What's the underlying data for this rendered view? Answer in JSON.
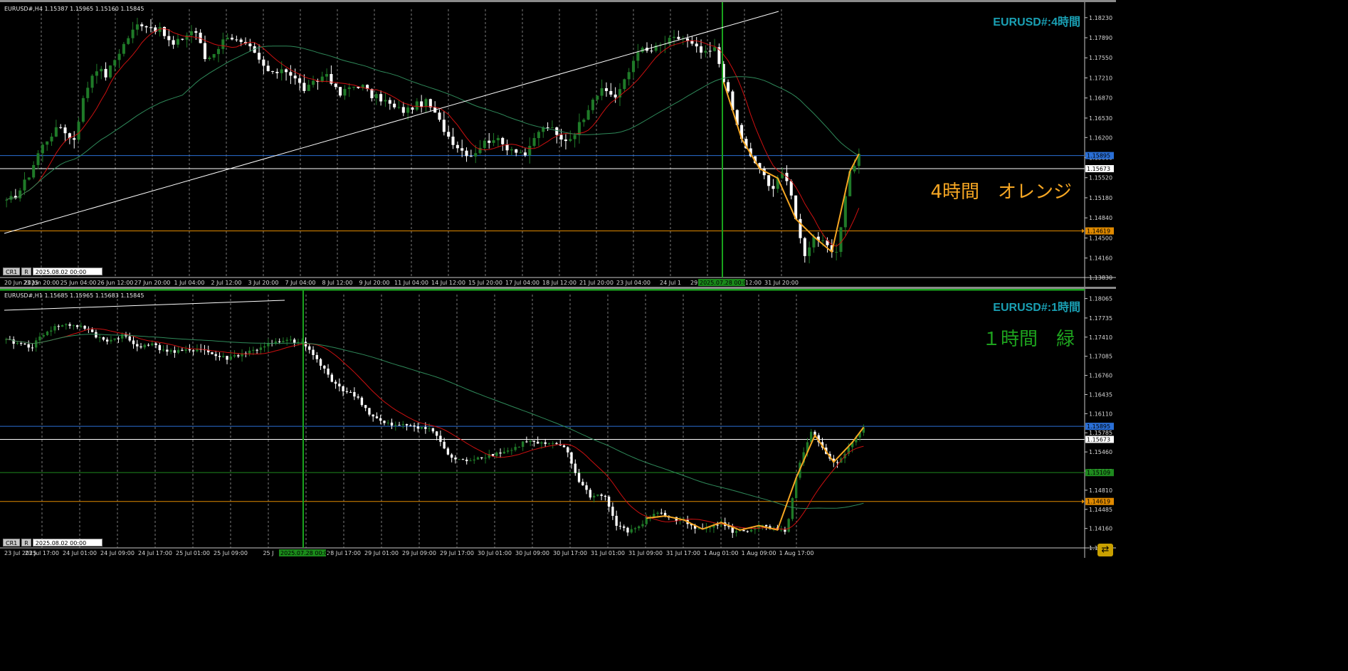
{
  "colors": {
    "background": "#000000",
    "grid": "#9a9a9a",
    "candle_up": "#1f7a28",
    "candle_down": "#ffffff",
    "ma_red": "#cc1010",
    "ma_green": "#2f8a5a",
    "zigzag_orange": "#f5a623",
    "hline_blue": "#2a6fd6",
    "hline_white": "#ffffff",
    "hline_orange": "#e08a00",
    "hline_green": "#1e8a1e",
    "vline_green": "#19a31c",
    "title_teal": "#1aa0b4",
    "note_orange": "#f5a623",
    "note_green": "#1ea31e"
  },
  "top": {
    "info": "EURUSD#,H4  1.15387 1.15965 1.15160 1.15845",
    "title": "EURUSD#:4時間",
    "note": "4時間　オレンジ",
    "cr_label": "CR1",
    "r_label": "R",
    "date_box": "2025.08.02 00:00",
    "vline_tag": "2025.07.28 00:00",
    "chart_data": {
      "type": "candlestick",
      "timeframe": "H4",
      "ylim": [
        1.1383,
        1.183
      ],
      "y_ticks": [
        "1.18230",
        "1.17890",
        "1.17550",
        "1.17210",
        "1.16870",
        "1.16530",
        "1.16200",
        "1.15860",
        "1.15520",
        "1.15180",
        "1.14840",
        "1.14500",
        "1.14160",
        "1.13830"
      ],
      "x_ticks": [
        "20 Jun 2025",
        "23 Jun 20:00",
        "25 Jun 04:00",
        "26 Jun 12:00",
        "27 Jun 20:00",
        "1 Jul 04:00",
        "2 Jul 12:00",
        "3 Jul 20:00",
        "7 Jul 04:00",
        "8 Jul 12:00",
        "9 Jul 20:00",
        "11 Jul 04:00",
        "14 Jul 12:00",
        "15 Jul 20:00",
        "17 Jul 04:00",
        "18 Jul 12:00",
        "21 Jul 20:00",
        "23 Jul 04:00",
        "24 Jul 1",
        "29 Jul 04:00",
        "30 Jul 12:00",
        "31 Jul 20:00"
      ],
      "hlines": [
        {
          "label": "1.15895",
          "value": 1.15895,
          "color": "blue"
        },
        {
          "label": "1.15673",
          "value": 1.15673,
          "color": "white"
        },
        {
          "label": "1.14619",
          "value": 1.14619,
          "color": "orange"
        }
      ],
      "close_path": [
        1.151,
        1.1525,
        1.1555,
        1.16,
        1.1625,
        1.164,
        1.161,
        1.169,
        1.174,
        1.1725,
        1.176,
        1.179,
        1.1815,
        1.1808,
        1.18,
        1.1775,
        1.179,
        1.1805,
        1.175,
        1.177,
        1.1795,
        1.178,
        1.177,
        1.1745,
        1.1725,
        1.174,
        1.172,
        1.17,
        1.1715,
        1.173,
        1.169,
        1.1705,
        1.171,
        1.169,
        1.1685,
        1.167,
        1.1665,
        1.1675,
        1.168,
        1.165,
        1.162,
        1.16,
        1.159,
        1.161,
        1.162,
        1.1605,
        1.16,
        1.159,
        1.163,
        1.164,
        1.1615,
        1.162,
        1.165,
        1.169,
        1.17,
        1.169,
        1.172,
        1.177,
        1.1765,
        1.1775,
        1.1785,
        1.179,
        1.1775,
        1.176,
        1.177,
        1.1705,
        1.164,
        1.159,
        1.157,
        1.153,
        1.1565,
        1.1515,
        1.142,
        1.1455,
        1.1435,
        1.142,
        1.1555,
        1.159
      ]
    }
  },
  "bottom": {
    "info": "EURUSD#,H1  1.15685 1.15965 1.15683 1.15845",
    "title": "EURUSD#:1時間",
    "note": "１時間　緑",
    "cr_label": "CR1",
    "r_label": "R",
    "date_box": "2025.08.02 00:00",
    "vline_tag": "2025.07.28 00:00",
    "chart_data": {
      "type": "candlestick",
      "timeframe": "H1",
      "ylim": [
        1.1383,
        1.1806
      ],
      "y_ticks": [
        "1.18065",
        "1.17735",
        "1.17410",
        "1.17085",
        "1.16760",
        "1.16435",
        "1.16110",
        "1.15785",
        "1.15460",
        "1.15135",
        "1.14810",
        "1.14485",
        "1.14160",
        "1.13830"
      ],
      "x_ticks": [
        "23 Jul 2025",
        "23 Jul 17:00",
        "24 Jul 01:00",
        "24 Jul 09:00",
        "24 Jul 17:00",
        "25 Jul 01:00",
        "25 Jul 09:00",
        "25 J",
        "28 Jul 09:00",
        "28 Jul 17:00",
        "29 Jul 01:00",
        "29 Jul 09:00",
        "29 Jul 17:00",
        "30 Jul 01:00",
        "30 Jul 09:00",
        "30 Jul 17:00",
        "31 Jul 01:00",
        "31 Jul 09:00",
        "31 Jul 17:00",
        "1 Aug 01:00",
        "1 Aug 09:00",
        "1 Aug 17:00"
      ],
      "hlines": [
        {
          "label": "1.15895",
          "value": 1.15895,
          "color": "blue"
        },
        {
          "label": "1.15673",
          "value": 1.15673,
          "color": "white"
        },
        {
          "label": "1.15109",
          "value": 1.15109,
          "color": "green"
        },
        {
          "label": "1.14619",
          "value": 1.14619,
          "color": "orange"
        }
      ],
      "close_path": [
        1.1735,
        1.173,
        1.1725,
        1.175,
        1.176,
        1.1762,
        1.1758,
        1.174,
        1.1735,
        1.1745,
        1.1725,
        1.173,
        1.172,
        1.1715,
        1.1718,
        1.1722,
        1.171,
        1.1705,
        1.1712,
        1.1718,
        1.1728,
        1.1732,
        1.1735,
        1.1728,
        1.17,
        1.167,
        1.165,
        1.164,
        1.161,
        1.1595,
        1.159,
        1.1592,
        1.1588,
        1.158,
        1.154,
        1.153,
        1.1535,
        1.154,
        1.1545,
        1.155,
        1.1565,
        1.156,
        1.1558,
        1.1555,
        1.15,
        1.147,
        1.1475,
        1.142,
        1.141,
        1.1425,
        1.1445,
        1.1435,
        1.143,
        1.1415,
        1.142,
        1.1425,
        1.141,
        1.1412,
        1.142,
        1.1415,
        1.1408,
        1.152,
        1.158,
        1.1545,
        1.1525,
        1.156,
        1.1585
      ]
    }
  },
  "labels": {
    "scroll_icon": "⇄"
  }
}
